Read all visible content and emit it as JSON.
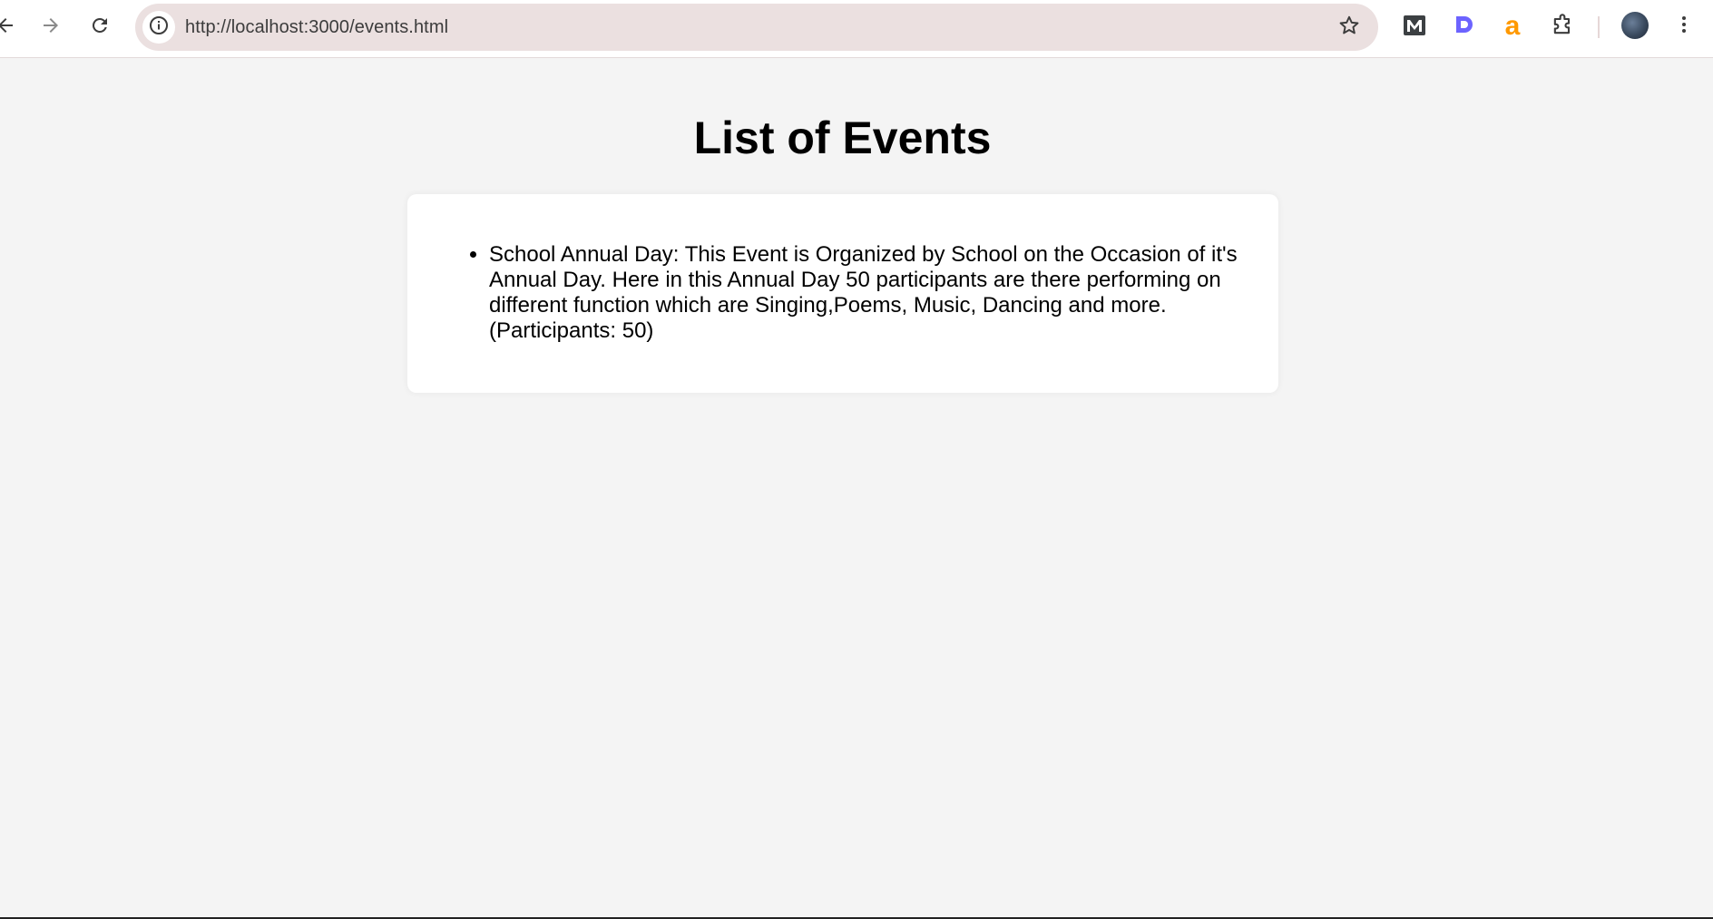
{
  "browser": {
    "url": "http://localhost:3000/events.html",
    "icons": {
      "back": "back-arrow-icon",
      "forward": "forward-arrow-icon",
      "reload": "reload-icon",
      "site_info": "info-icon",
      "bookmark": "star-icon",
      "extension_m": "m-extension-icon",
      "extension_d": "d-extension-icon",
      "extension_a": "a-extension-icon",
      "extensions": "puzzle-icon",
      "menu": "kebab-menu-icon"
    },
    "colors": {
      "omnibox_bg": "#ebe0e0",
      "ext_m": "#3c4043",
      "ext_d": "#6c63ff",
      "ext_a": "#ff9900"
    }
  },
  "page": {
    "title": "List of Events",
    "events": [
      {
        "text": "School Annual Day: This Event is Organized by School on the Occasion of it's Annual Day. Here in this Annual Day 50 participants are there performing on different function which are Singing,Poems, Music, Dancing and more. (Participants: 50)"
      }
    ]
  }
}
